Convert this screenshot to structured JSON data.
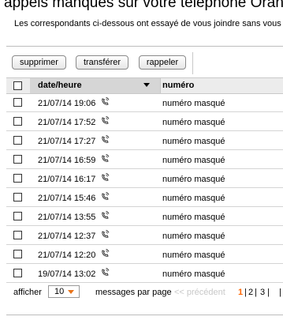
{
  "header": {
    "title": "appels manqués sur votre téléphone Orange",
    "subtitle": "Les correspondants ci-dessous ont essayé de vous joindre sans vous"
  },
  "toolbar": {
    "delete_label": "supprimer",
    "forward_label": "transférer",
    "callback_label": "rappeler"
  },
  "table": {
    "columns": [
      "date/heure",
      "numéro"
    ],
    "rows": [
      {
        "date": "21/07/14 19:06",
        "number": "numéro masqué"
      },
      {
        "date": "21/07/14 17:52",
        "number": "numéro masqué"
      },
      {
        "date": "21/07/14 17:27",
        "number": "numéro masqué"
      },
      {
        "date": "21/07/14 16:59",
        "number": "numéro masqué"
      },
      {
        "date": "21/07/14 16:17",
        "number": "numéro masqué"
      },
      {
        "date": "21/07/14 15:46",
        "number": "numéro masqué"
      },
      {
        "date": "21/07/14 13:55",
        "number": "numéro masqué"
      },
      {
        "date": "21/07/14 12:37",
        "number": "numéro masqué"
      },
      {
        "date": "21/07/14 12:20",
        "number": "numéro masqué"
      },
      {
        "date": "19/07/14 13:02",
        "number": "numéro masqué"
      }
    ],
    "row_icon": "missed-call-phone-icon"
  },
  "pagination": {
    "show_label": "afficher",
    "per_page_value": "10",
    "per_page_label": "messages par page",
    "prev_label": "<< précédent",
    "pages": [
      "1",
      "2",
      "3"
    ],
    "current_page": "1"
  },
  "colors": {
    "accent": "#ff6600",
    "header_bg": "#ececec",
    "sorted_col_bg": "#d6d6d6"
  }
}
